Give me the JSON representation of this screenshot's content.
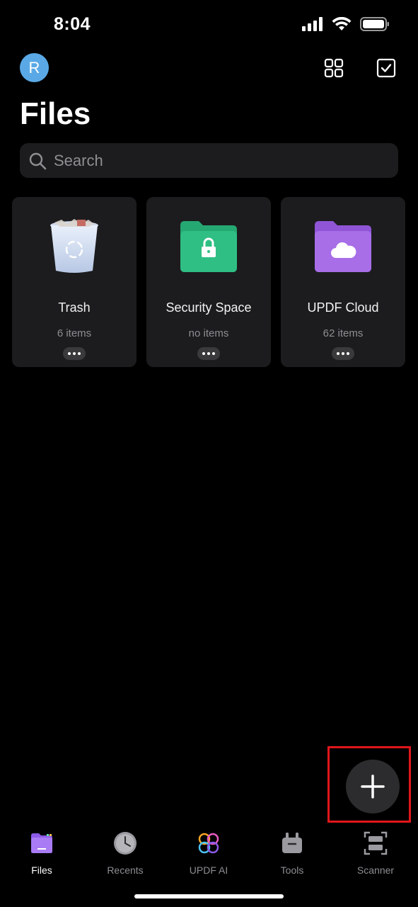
{
  "status": {
    "time": "8:04"
  },
  "header": {
    "avatar_initial": "R",
    "title": "Files",
    "grid_icon": "grid-icon",
    "select_icon": "checkbox-select-icon"
  },
  "search": {
    "placeholder": "Search"
  },
  "cards": [
    {
      "title": "Trash",
      "count": "6 items",
      "icon": "trash-bin-icon"
    },
    {
      "title": "Security Space",
      "count": "no items",
      "icon": "lock-folder-icon"
    },
    {
      "title": "UPDF Cloud",
      "count": "62 items",
      "icon": "cloud-folder-icon"
    }
  ],
  "fab": {
    "icon": "plus-icon",
    "highlight_color": "#e0161b"
  },
  "tabs": [
    {
      "label": "Files",
      "active": true
    },
    {
      "label": "Recents",
      "active": false
    },
    {
      "label": "UPDF AI",
      "active": false
    },
    {
      "label": "Tools",
      "active": false
    },
    {
      "label": "Scanner",
      "active": false
    }
  ],
  "colors": {
    "background": "#000000",
    "card": "#1c1c1e",
    "security_green": "#2fbf84",
    "cloud_purple": "#a86ee8",
    "avatar_blue": "#5aa9e6"
  }
}
